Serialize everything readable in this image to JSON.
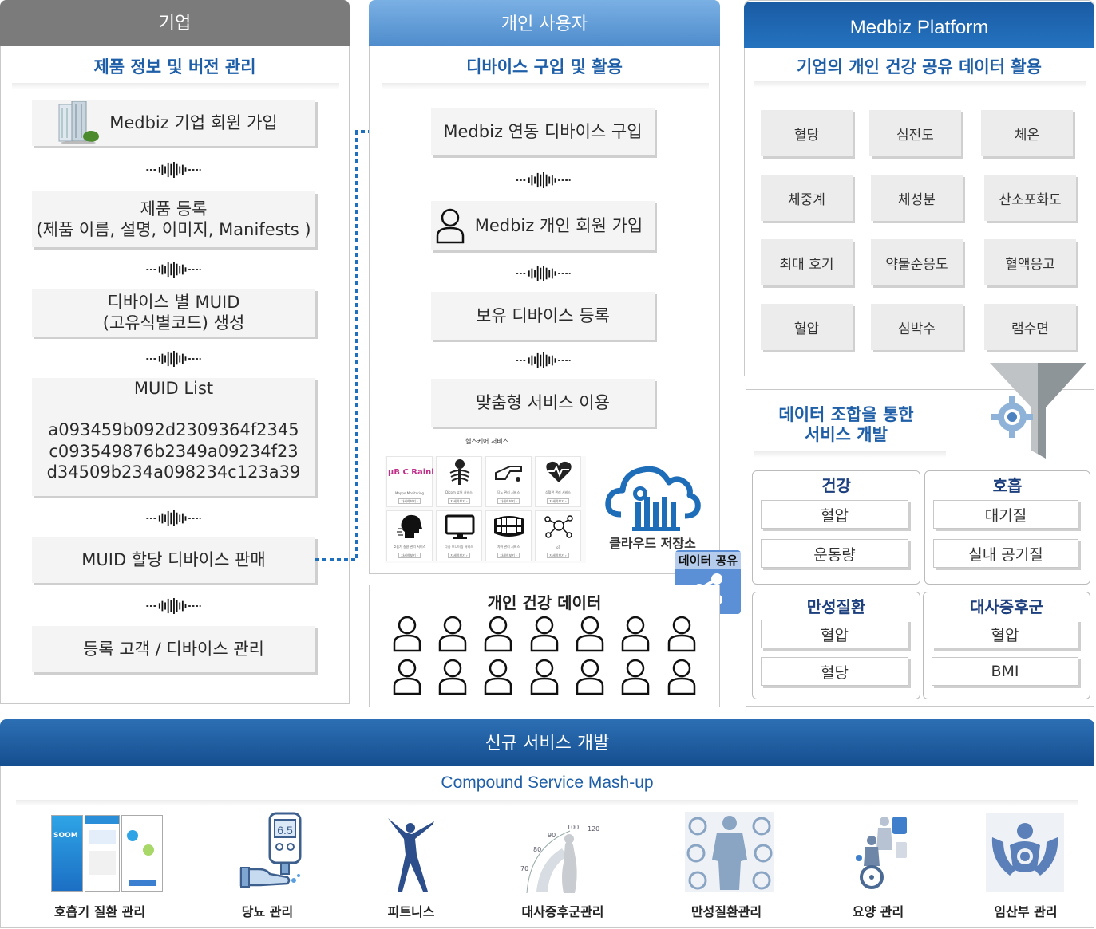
{
  "company": {
    "header": "기업",
    "subtitle": "제품 정보 및 버전 관리",
    "steps": {
      "join": "Medbiz 기업 회원 가입",
      "register_l1": "제품 등록",
      "register_l2": "(제품 이름, 설명, 이미지, Manifests )",
      "muid_l1": "디바이스 별 MUID",
      "muid_l2": "(고유식별코드) 생성",
      "list_title": "MUID List",
      "list_1": "a093459b092d2309364f2345",
      "list_2": "c093549876b2349a09234f23",
      "list_3": "d34509b234a098234c123a39",
      "sell": "MUID 할당 디바이스 판매",
      "manage": "등록 고객 / 디바이스 관리"
    }
  },
  "personal": {
    "header": "개인 사용자",
    "subtitle": "디바이스 구입 및 활용",
    "steps": {
      "buy": "Medbiz 연동 디바이스 구입",
      "join": "Medbiz 개인 회원 가입",
      "register": "보유 디바이스 등록",
      "use": "맞춤형 서비스 이용"
    },
    "healthcare_label": "헬스케어 서비스",
    "healthcare_services": [
      {
        "cap": "Meppo Monitoring",
        "btn": "자세히보기 ›"
      },
      {
        "cap": "Dicom 뷰어 서비스",
        "btn": "자세히보기 ›"
      },
      {
        "cap": "당뇨 관리 서비스",
        "btn": "자세히보기 ›"
      },
      {
        "cap": "심혈관 관리 서비스",
        "btn": "자세히보기 ›"
      },
      {
        "cap": "호흡기 질환 관리 서비스",
        "btn": "자세히보기 ›"
      },
      {
        "cap": "다중 모니터링 서비스",
        "btn": "자세히보기 ›"
      },
      {
        "cap": "치아 관리 서비스",
        "btn": "자세히보기 ›"
      },
      {
        "cap": "IoT",
        "btn": "자세히보기 ›"
      }
    ],
    "logo_text": "μB C Rainbow",
    "cloud_label": "클라우드 저장소",
    "share_label": "데이터 공유",
    "health_data_title": "개인 건강 데이터"
  },
  "platform": {
    "header": "Medbiz Platform",
    "subtitle": "기업의 개인 건강 공유 데이터  활용",
    "tiles": [
      "혈당",
      "심전도",
      "체온",
      "체중계",
      "체성분",
      "산소포화도",
      "최대 호기",
      "약물순응도",
      "혈액응고",
      "혈압",
      "심박수",
      "램수면"
    ]
  },
  "combo": {
    "title_l1": "데이터 조합을 통한",
    "title_l2": "서비스 개발",
    "groups": [
      {
        "title": "건강",
        "items": [
          "혈압",
          "운동량"
        ]
      },
      {
        "title": "호흡",
        "items": [
          "대기질",
          "실내 공기질"
        ]
      },
      {
        "title": "만성질환",
        "items": [
          "혈압",
          "혈당"
        ]
      },
      {
        "title": "대사증후군",
        "items": [
          "혈압",
          "BMI"
        ]
      }
    ]
  },
  "bottom": {
    "header": "신규 서비스 개발",
    "subtitle": "Compound Service Mash-up",
    "services": [
      "호흡기 질환 관리",
      "당뇨 관리",
      "피트니스",
      "대사증후군관리",
      "만성질환관리",
      "요양 관리",
      "임산부 관리"
    ],
    "glucose_reading": "6.5",
    "gauge_ticks": [
      "70",
      "80",
      "90",
      "100",
      "120"
    ],
    "app_brand": "SOOM"
  },
  "colors": {
    "company_header": "#7b7b7b",
    "personal_header": "#5b98d6",
    "platform_header": "#1e64ad",
    "bottom_header": "#1b5a9e",
    "accent_text": "#1e5fa8",
    "arrow": "#1f6fbf"
  }
}
